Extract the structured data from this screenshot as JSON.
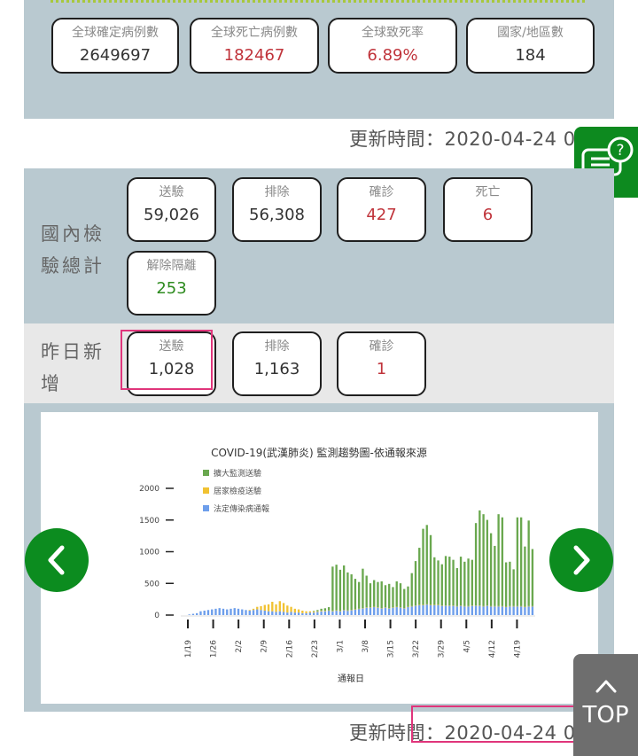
{
  "global": {
    "confirmed": {
      "label": "全球確定病例數",
      "value": "2649697"
    },
    "deaths": {
      "label": "全球死亡病例數",
      "value": "182467"
    },
    "fatality": {
      "label": "全球致死率",
      "value": "6.89%"
    },
    "countries": {
      "label": "國家/地區數",
      "value": "184"
    }
  },
  "update_time_1": "更新時間：2020-04-24 0",
  "domestic": {
    "label": "國內檢驗總計",
    "cards": [
      {
        "label": "送驗",
        "value": "59,026"
      },
      {
        "label": "排除",
        "value": "56,308"
      },
      {
        "label": "確診",
        "value": "427"
      },
      {
        "label": "死亡",
        "value": "6"
      },
      {
        "label": "解除隔離",
        "value": "253"
      }
    ]
  },
  "yesterday": {
    "label": "昨日新增",
    "cards": [
      {
        "label": "送驗",
        "value": "1,028"
      },
      {
        "label": "排除",
        "value": "1,163"
      },
      {
        "label": "確診",
        "value": "1"
      }
    ]
  },
  "chart_data": {
    "type": "bar",
    "title": "COVID-19(武漢肺炎) 監測趨勢圖-依通報來源",
    "xlabel": "通報日",
    "ylabel": "",
    "ylim": [
      0,
      2000
    ],
    "yticks": [
      "2000",
      "1500",
      "1000",
      "500",
      "0"
    ],
    "xticks": [
      "1/19",
      "1/26",
      "2/2",
      "2/9",
      "2/16",
      "2/23",
      "3/1",
      "3/8",
      "3/15",
      "3/22",
      "3/29",
      "4/5",
      "4/12",
      "4/19"
    ],
    "legend_position": "top-left",
    "series": [
      {
        "name": "擴大監測送驗",
        "color": "#6aa84f",
        "values": [
          0,
          0,
          0,
          0,
          0,
          0,
          0,
          0,
          0,
          0,
          0,
          0,
          0,
          0,
          0,
          0,
          0,
          0,
          0,
          0,
          0,
          0,
          0,
          0,
          0,
          0,
          0,
          0,
          0,
          0,
          0,
          0,
          0,
          0,
          0,
          10,
          20,
          30,
          40,
          50,
          700,
          720,
          650,
          700,
          600,
          560,
          480,
          420,
          620,
          500,
          380,
          420,
          400,
          420,
          350,
          380,
          320,
          400,
          380,
          300,
          320,
          520,
          700,
          900,
          1200,
          1250,
          1100,
          750,
          700,
          650,
          780,
          770,
          720,
          600,
          770,
          700,
          750,
          720,
          1300,
          1500,
          1450,
          1350,
          1150,
          950,
          1450,
          1400,
          700,
          700,
          580,
          1400,
          1400,
          950,
          1350,
          900
        ]
      },
      {
        "name": "居家檢疫送驗",
        "color": "#f1c232",
        "values": [
          0,
          0,
          0,
          0,
          0,
          0,
          0,
          0,
          0,
          0,
          0,
          0,
          0,
          0,
          0,
          0,
          0,
          0,
          10,
          20,
          40,
          60,
          90,
          110,
          150,
          120,
          160,
          140,
          110,
          80,
          60,
          50,
          40,
          30,
          20,
          15,
          10,
          10,
          8,
          5,
          5,
          5,
          5,
          3,
          3,
          3,
          2,
          2,
          2,
          2,
          2,
          2,
          2,
          2,
          2,
          2,
          2,
          2,
          2,
          2,
          2,
          2,
          2,
          2,
          2,
          2,
          2,
          2,
          2,
          2,
          2,
          2,
          2,
          2,
          2,
          2,
          2,
          2,
          2,
          2,
          2,
          2,
          2,
          2,
          2,
          2,
          2,
          2,
          2,
          2,
          2,
          2,
          2,
          2
        ]
      },
      {
        "name": "法定傳染病通報",
        "color": "#6d9eeb",
        "values": [
          0,
          0,
          10,
          20,
          30,
          60,
          70,
          80,
          90,
          100,
          110,
          100,
          90,
          100,
          110,
          100,
          90,
          80,
          70,
          80,
          90,
          80,
          70,
          60,
          60,
          50,
          60,
          50,
          40,
          50,
          40,
          40,
          30,
          30,
          40,
          40,
          50,
          60,
          60,
          70,
          60,
          70,
          60,
          80,
          70,
          80,
          90,
          100,
          110,
          120,
          120,
          130,
          120,
          110,
          120,
          110,
          120,
          130,
          120,
          110,
          130,
          140,
          150,
          160,
          160,
          170,
          160,
          160,
          160,
          150,
          150,
          150,
          150,
          140,
          150,
          140,
          140,
          150,
          150,
          150,
          140,
          150,
          140,
          140,
          140,
          140,
          130,
          140,
          140,
          140,
          140,
          130,
          140,
          140
        ]
      }
    ]
  },
  "update_time_2": "更新時間：2020-04-24 0",
  "nav": {
    "prev_icon": "chevron-left-icon",
    "next_icon": "chevron-right-icon",
    "top_label": "TOP",
    "help_icon": "chat-help-icon"
  },
  "colors": {
    "accent": "#0c8c1f",
    "panel": "#b9c9d0",
    "highlight": "#e0357b",
    "negative": "#c0343b",
    "positive": "#2e8b1f"
  }
}
